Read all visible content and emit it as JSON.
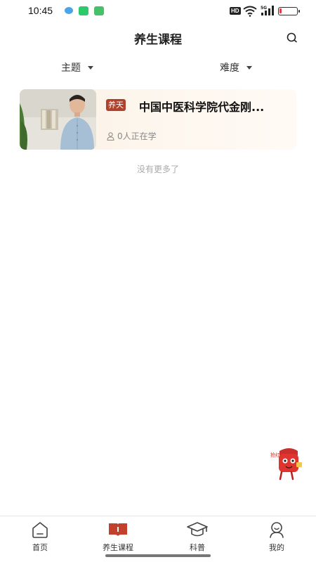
{
  "status_bar": {
    "time": "10:45",
    "hd": "HD",
    "network": "5G"
  },
  "header": {
    "title": "养生课程",
    "search_icon": "search-icon"
  },
  "filters": [
    {
      "label": "主题"
    },
    {
      "label": "难度"
    }
  ],
  "courses": [
    {
      "tag": "养天",
      "title": "中国中医科学院代金刚...",
      "learners": "0人正在学"
    }
  ],
  "list_footer": "没有更多了",
  "mascot_text": "抢红包",
  "bottom_nav": {
    "items": [
      {
        "label": "首页",
        "icon": "home-icon"
      },
      {
        "label": "养生课程",
        "icon": "book-icon",
        "active": true
      },
      {
        "label": "科普",
        "icon": "graduation-cap-icon"
      },
      {
        "label": "我的",
        "icon": "profile-icon"
      }
    ]
  },
  "colors": {
    "accent": "#b0412d",
    "card_bg": "#fbf1e3",
    "text_muted": "#888888"
  }
}
